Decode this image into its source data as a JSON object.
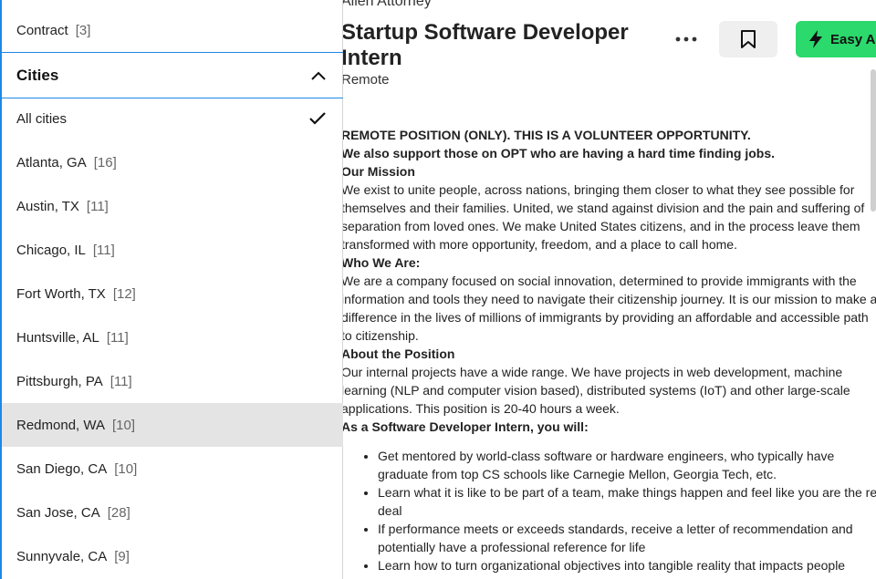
{
  "filters": {
    "contract": {
      "label": "Contract",
      "count": "[3]"
    },
    "cities": {
      "title": "Cities",
      "items": [
        {
          "label": "All cities",
          "count": "",
          "selected": true
        },
        {
          "label": "Atlanta, GA",
          "count": "[16]"
        },
        {
          "label": "Austin, TX",
          "count": "[11]"
        },
        {
          "label": "Chicago, IL",
          "count": "[11]"
        },
        {
          "label": "Fort Worth, TX",
          "count": "[12]"
        },
        {
          "label": "Huntsville, AL",
          "count": "[11]"
        },
        {
          "label": "Pittsburgh, PA",
          "count": "[11]"
        },
        {
          "label": "Redmond, WA",
          "count": "[10]",
          "hovered": true
        },
        {
          "label": "San Diego, CA",
          "count": "[10]"
        },
        {
          "label": "San Jose, CA",
          "count": "[28]"
        },
        {
          "label": "Sunnyvale, CA",
          "count": "[9]"
        }
      ]
    }
  },
  "job": {
    "company": "Allen Attorney",
    "title": "Startup Software Developer Intern",
    "location": "Remote",
    "easy_apply_label": "Easy Apply",
    "description": {
      "line1": "REMOTE POSITION (ONLY). THIS IS A VOLUNTEER OPPORTUNITY.",
      "line2": "We also support those on OPT who are having a hard time finding jobs.",
      "mission_heading": "Our Mission",
      "mission_1": "We exist to unite people, across nations, bringing them closer to what they see possible for",
      "mission_2": "themselves and their families. United, we stand against division and the pain and suffering of",
      "mission_3": "separation from loved ones. We make United States citizens, and in the process leave them",
      "mission_4": "transformed with more opportunity, freedom, and a place to call home.",
      "who_heading": "Who We Are:",
      "who_1": "We are a company focused on social innovation, determined to provide immigrants with the",
      "who_2": "information and tools they need to navigate their citizenship journey. It is our mission to make a",
      "who_3": "difference in the lives of millions of immigrants by providing an affordable and accessible path",
      "who_4": "to citizenship.",
      "about_heading": "About the Position",
      "about_1": "Our internal projects have a wide range. We have projects in web development, machine",
      "about_2": "learning (NLP and computer vision based), distributed systems (IoT) and other large-scale",
      "about_3": "applications. This position is 20-40 hours a week.",
      "intern_heading": "As a Software Developer Intern, you will:",
      "bullets": [
        {
          "a": "Get mentored by world-class software or hardware engineers, who typically have",
          "b": "graduate from top CS schools like Carnegie Mellon, Georgia Tech, etc."
        },
        {
          "a": "Learn what it is like to be part of a team, make things happen and feel like you are the real",
          "b": "deal"
        },
        {
          "a": "If performance meets or exceeds standards, receive a letter of recommendation and",
          "b": "potentially have a professional reference for life"
        },
        {
          "a": "Learn how to turn organizational objectives into tangible reality that impacts people",
          "b": ""
        }
      ]
    }
  },
  "colors": {
    "accent_blue": "#1e88e5",
    "apply_green": "#2bd96d",
    "hover_gray": "#e4e4e4"
  },
  "icons": {
    "chevron": "chevron-up-icon",
    "check": "check-icon",
    "more": "more-horizontal-icon",
    "save": "bookmark-icon",
    "apply": "lightning-icon"
  }
}
